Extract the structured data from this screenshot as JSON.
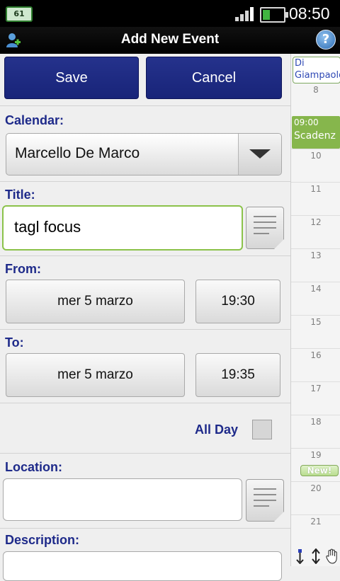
{
  "status_bar": {
    "notification_badge": "61",
    "time": "08:50"
  },
  "title_bar": {
    "title": "Add New Event",
    "help_label": "?"
  },
  "actions": {
    "save_label": "Save",
    "cancel_label": "Cancel"
  },
  "calendar": {
    "label": "Calendar:",
    "selected": "Marcello De Marco"
  },
  "title_field": {
    "label": "Title:",
    "value": "tagl focus"
  },
  "from": {
    "label": "From:",
    "date": "mer 5 marzo",
    "time": "19:30"
  },
  "to": {
    "label": "To:",
    "date": "mer 5 marzo",
    "time": "19:35"
  },
  "all_day": {
    "label": "All Day",
    "checked": false
  },
  "location": {
    "label": "Location:",
    "value": ""
  },
  "description": {
    "label": "Description:"
  },
  "day_sidebar": {
    "event_top": {
      "title": "Di Giampaolo Mirk"
    },
    "event_scadenza": {
      "time": "09:00",
      "title": "Scadenz"
    },
    "hours": [
      "8",
      "10",
      "11",
      "12",
      "13",
      "14",
      "15",
      "16",
      "17",
      "18",
      "19",
      "20",
      "21"
    ],
    "new_badge": "New!"
  },
  "colors": {
    "button_blue": "#1f2b85",
    "label_blue": "#1e2a8a",
    "active_border": "#8bc24a",
    "event_green": "#86b64c"
  }
}
